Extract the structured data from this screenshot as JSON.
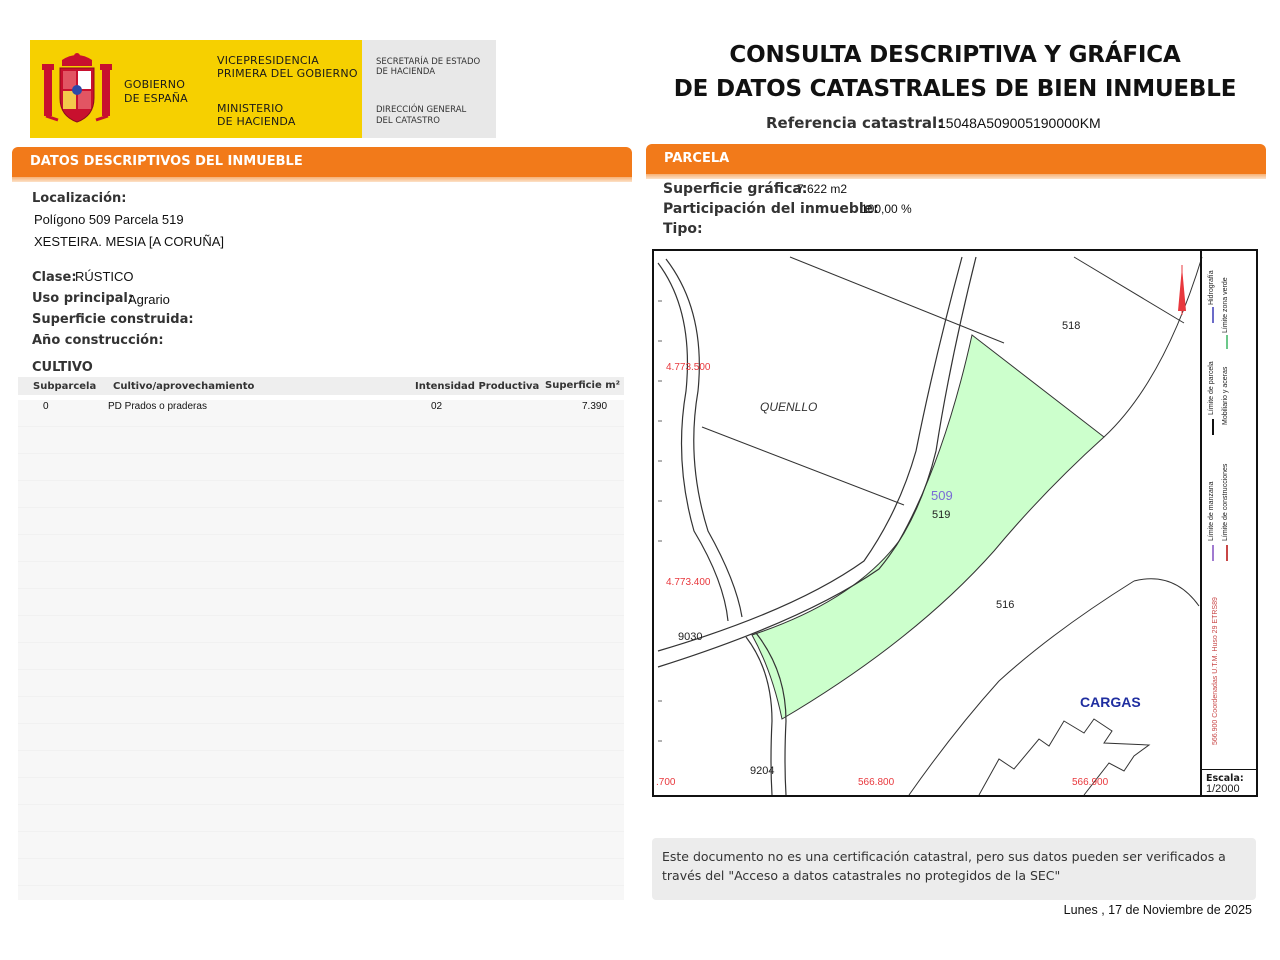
{
  "header": {
    "gov_line1": "GOBIERNO",
    "gov_line2": "DE ESPAÑA",
    "vice_line1": "VICEPRESIDENCIA",
    "vice_line2": "PRIMERA DEL GOBIERNO",
    "min_line1": "MINISTERIO",
    "min_line2": "DE HACIENDA",
    "sec_line1": "SECRETARÍA DE ESTADO",
    "sec_line2": "DE HACIENDA",
    "dir_line1": "DIRECCIÓN GENERAL",
    "dir_line2": "DEL CATASTRO",
    "logo_icon": "spain-coat-of-arms-icon",
    "brand_yellow": "#f6d000",
    "accent_orange": "#f27a1a"
  },
  "title": {
    "line1": "CONSULTA DESCRIPTIVA Y GRÁFICA",
    "line2": "DE DATOS CATASTRALES DE BIEN INMUEBLE",
    "ref_label": "Referencia catastral:",
    "ref_value": "15048A509005190000KM"
  },
  "left": {
    "section_title": "DATOS DESCRIPTIVOS DEL INMUEBLE",
    "localizacion_label": "Localización:",
    "localizacion_line1": "Polígono 509 Parcela 519",
    "localizacion_line2": "XESTEIRA. MESIA [A CORUÑA]",
    "clase_label": "Clase:",
    "clase_value": "RÚSTICO",
    "uso_label": "Uso principal:",
    "uso_value": "Agrario",
    "superficie_label": "Superficie construida:",
    "anio_label": "Año construcción:",
    "cultivo_title": "CULTIVO",
    "cultivo_headers": {
      "subparcela": "Subparcela",
      "cultivo": "Cultivo/aprovechamiento",
      "intensidad": "Intensidad Productiva",
      "superficie": "Superficie m²"
    },
    "cultivo_rows": [
      {
        "subparcela": "0",
        "cultivo": "PD Prados o praderas",
        "intensidad": "02",
        "superficie": "7.390"
      }
    ]
  },
  "right": {
    "section_title": "PARCELA",
    "superficie_label": "Superficie gráfica:",
    "superficie_value": "7.622 m2",
    "participacion_label": "Participación del inmueble:",
    "participacion_value": "100,00 %",
    "tipo_label": "Tipo:",
    "map": {
      "parcel_fill": "#ccffcc",
      "labels": {
        "quenllo": "QUENLLO",
        "cargas": "CARGAS",
        "poligono": "509",
        "parcela": "519",
        "p518": "518",
        "p516": "516",
        "road9030": "9030",
        "road9204": "9204",
        "y_4773500": "4.773.500",
        "y_4773400": "4.773.400",
        "x_700": ".700",
        "x_566800": "566.800",
        "x_566900": "566.900"
      },
      "north_icon": "north-arrow-icon"
    },
    "legend": {
      "col1": [
        "Hidrografía",
        "Límite de parcela",
        "Límite de manzana",
        "566.900 Coordenadas U.T.M. Huso 29 ETRS89"
      ],
      "col2": [
        "Límite zona verde",
        "Mobiliario y aceras",
        "Límite de construcciones"
      ]
    },
    "scale_label": "Escala:",
    "scale_value": "1/2000"
  },
  "footer": {
    "note": "Este documento no es una certificación catastral, pero sus datos pueden ser verificados a través del \"Acceso a datos catastrales no protegidos de la SEC\"",
    "date": "Lunes , 17 de Noviembre de 2025"
  }
}
